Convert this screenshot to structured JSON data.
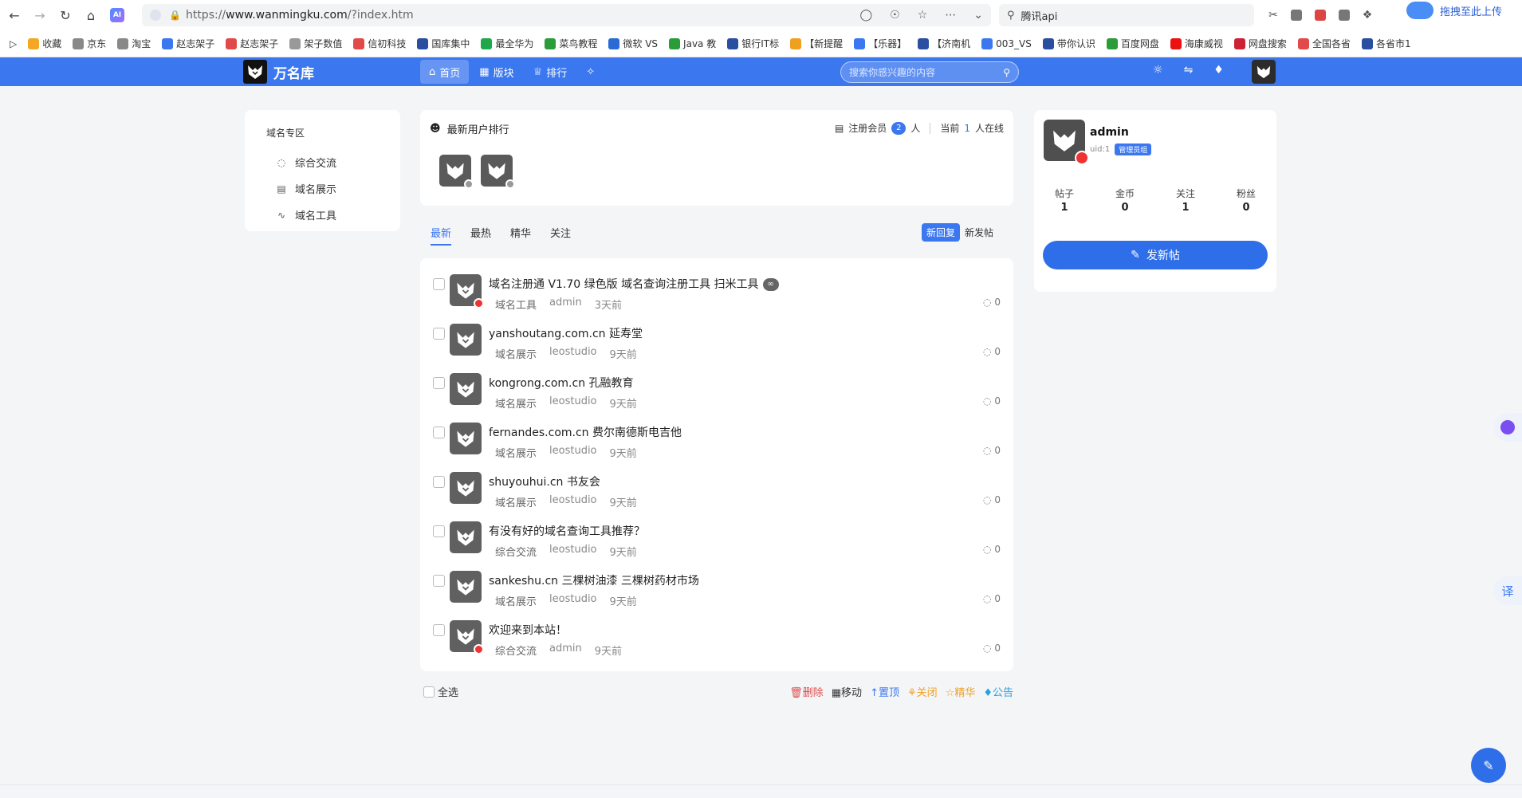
{
  "browser": {
    "url_scheme": "https://",
    "url_host": "www.wanmingku.com",
    "url_path": "/?index.htm",
    "search_text": "腾讯api",
    "ai_label": "AI",
    "baidu_upload": "拖拽至此上传",
    "bookmarks": [
      {
        "label": "收藏",
        "color": "#f5a623"
      },
      {
        "label": "京东",
        "color": "#888888"
      },
      {
        "label": "淘宝",
        "color": "#888888"
      },
      {
        "label": "赵志架子",
        "color": "#3b78f0"
      },
      {
        "label": "赵志架子",
        "color": "#e14a4a"
      },
      {
        "label": "架子数值",
        "color": "#999999"
      },
      {
        "label": "信初科技",
        "color": "#e14a4a"
      },
      {
        "label": "国库集中",
        "color": "#2a4ea0"
      },
      {
        "label": "最全华为",
        "color": "#1fa84a"
      },
      {
        "label": "菜鸟教程",
        "color": "#2a9d3a"
      },
      {
        "label": "微软 VS",
        "color": "#2a6bd6"
      },
      {
        "label": "Java 教",
        "color": "#2a9d3a"
      },
      {
        "label": "银行IT标",
        "color": "#2a4ea0"
      },
      {
        "label": "【新提醒",
        "color": "#f0a020"
      },
      {
        "label": "【乐器】",
        "color": "#3b78f0"
      },
      {
        "label": "【济南机",
        "color": "#2a4ea0"
      },
      {
        "label": "003_VS",
        "color": "#3b78f0"
      },
      {
        "label": "带你认识",
        "color": "#2a4ea0"
      },
      {
        "label": "百度网盘",
        "color": "#2a9d3a"
      },
      {
        "label": "海康威视",
        "color": "#e11"
      },
      {
        "label": "网盘搜索",
        "color": "#c23"
      },
      {
        "label": "全国各省",
        "color": "#e14a4a"
      },
      {
        "label": "各省市1",
        "color": "#2a4ea0"
      }
    ]
  },
  "site": {
    "name": "万名库",
    "nav": [
      {
        "label": "首页",
        "icon": "home-icon",
        "active": true
      },
      {
        "label": "版块",
        "icon": "grid-icon",
        "active": false
      },
      {
        "label": "排行",
        "icon": "trophy-icon",
        "active": false
      }
    ],
    "search_placeholder": "搜索你感兴趣的内容"
  },
  "sidebar": {
    "title": "域名专区",
    "items": [
      {
        "label": "综合交流",
        "icon": "chat-icon"
      },
      {
        "label": "域名展示",
        "icon": "display-icon"
      },
      {
        "label": "域名工具",
        "icon": "activity-icon"
      }
    ]
  },
  "users_panel": {
    "title": "最新用户排行",
    "members_label": "注册会员",
    "members_count": "2",
    "members_unit": "人",
    "online_prefix": "当前",
    "online_count": "1",
    "online_suffix": "人在线"
  },
  "feed": {
    "tabs": [
      "最新",
      "最热",
      "精华",
      "关注"
    ],
    "sort": [
      "新回复",
      "新发帖"
    ],
    "posts": [
      {
        "title": "域名注册通 V1.70 绿色版 域名查询注册工具 扫米工具",
        "category": "域名工具",
        "author": "admin",
        "time": "3天前",
        "comments": "0",
        "admin": true,
        "has_link": true
      },
      {
        "title": "yanshoutang.com.cn 延寿堂",
        "category": "域名展示",
        "author": "leostudio",
        "time": "9天前",
        "comments": "0",
        "admin": false,
        "has_link": false
      },
      {
        "title": "kongrong.com.cn 孔融教育",
        "category": "域名展示",
        "author": "leostudio",
        "time": "9天前",
        "comments": "0",
        "admin": false,
        "has_link": false
      },
      {
        "title": "fernandes.com.cn 费尔南德斯电吉他",
        "category": "域名展示",
        "author": "leostudio",
        "time": "9天前",
        "comments": "0",
        "admin": false,
        "has_link": false
      },
      {
        "title": "shuyouhui.cn 书友会",
        "category": "域名展示",
        "author": "leostudio",
        "time": "9天前",
        "comments": "0",
        "admin": false,
        "has_link": false
      },
      {
        "title": "有没有好的域名查询工具推荐？",
        "category": "综合交流",
        "author": "leostudio",
        "time": "9天前",
        "comments": "0",
        "admin": false,
        "has_link": false
      },
      {
        "title": "sankeshu.cn 三棵树油漆 三棵树药材市场",
        "category": "域名展示",
        "author": "leostudio",
        "time": "9天前",
        "comments": "0",
        "admin": false,
        "has_link": false
      },
      {
        "title": "欢迎来到本站！",
        "category": "综合交流",
        "author": "admin",
        "time": "9天前",
        "comments": "0",
        "admin": true,
        "has_link": false
      }
    ],
    "select_all": "全选",
    "actions": {
      "delete": "删除",
      "move": "移动",
      "top": "置顶",
      "close": "关闭",
      "best": "精华",
      "notice": "公告"
    }
  },
  "profile": {
    "name": "admin",
    "uid": "uid:1",
    "role": "管理员组",
    "stats": [
      {
        "label": "帖子",
        "value": "1"
      },
      {
        "label": "金币",
        "value": "0"
      },
      {
        "label": "关注",
        "value": "1"
      },
      {
        "label": "粉丝",
        "value": "0"
      }
    ],
    "new_post_label": "发新帖"
  },
  "floating": {
    "translate_label": "译"
  }
}
